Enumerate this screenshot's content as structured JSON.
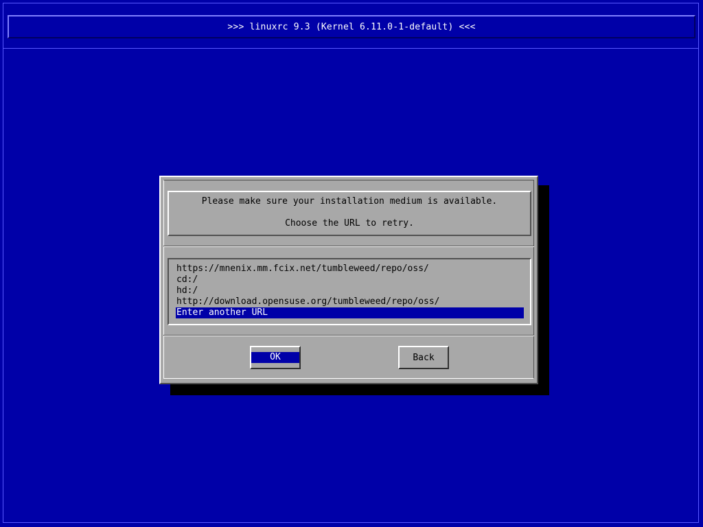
{
  "header": {
    "title": ">>> linuxrc 9.3 (Kernel 6.11.0-1-default) <<<"
  },
  "dialog": {
    "message_line1": "Please make sure your installation medium is available.",
    "message_line2": "Choose the URL to retry.",
    "urls": [
      "https://mnenix.mm.fcix.net/tumbleweed/repo/oss/",
      "cd:/",
      "hd:/",
      "http://download.opensuse.org/tumbleweed/repo/oss/",
      "Enter another URL"
    ],
    "selected_index": 4,
    "buttons": {
      "ok": "OK",
      "back": "Back"
    }
  },
  "colors": {
    "background": "#0000a8",
    "dialog": "#a8a8a8",
    "highlight": "#0000a8",
    "shadow": "#000000"
  }
}
